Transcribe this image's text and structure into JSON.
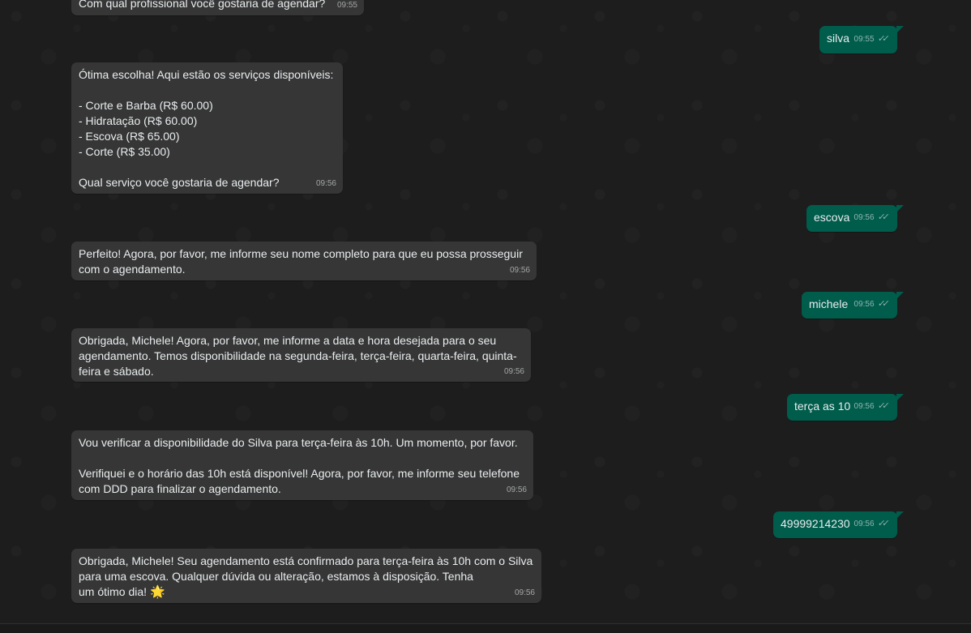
{
  "messages": [
    {
      "id": "m0",
      "dir": "in",
      "text": "Com qual profissional você gostaria de agendar?",
      "time": "09:55"
    },
    {
      "id": "m1",
      "dir": "out",
      "text": "silva",
      "time": "09:55"
    },
    {
      "id": "m2",
      "dir": "in",
      "text": "Ótima escolha! Aqui estão os serviços disponíveis:\n\n- Corte e Barba (R$ 60.00)\n- Hidratação (R$ 60.00)\n- Escova (R$ 65.00)\n- Corte (R$ 35.00)\n\nQual serviço você gostaria de agendar?",
      "time": "09:56"
    },
    {
      "id": "m3",
      "dir": "out",
      "text": "escova",
      "time": "09:56"
    },
    {
      "id": "m4",
      "dir": "in",
      "text": "Perfeito! Agora, por favor, me informe seu nome completo para que eu possa prosseguir\ncom o agendamento.",
      "time": "09:56"
    },
    {
      "id": "m5",
      "dir": "out",
      "text": "michele",
      "time": "09:56"
    },
    {
      "id": "m6",
      "dir": "in",
      "text": "Obrigada, Michele! Agora, por favor, me informe a data e hora desejada para o seu\nagendamento. Temos disponibilidade na segunda-feira, terça-feira, quarta-feira, quinta-\nfeira e sábado.",
      "time": "09:56"
    },
    {
      "id": "m7",
      "dir": "out",
      "text": "terça as 10",
      "time": "09:56"
    },
    {
      "id": "m8",
      "dir": "in",
      "text": "Vou verificar a disponibilidade do Silva para terça-feira às 10h. Um momento, por favor.\n\nVerifiquei e o horário das 10h está disponível! Agora, por favor, me informe seu telefone\ncom DDD para finalizar o agendamento.",
      "time": "09:56"
    },
    {
      "id": "m9",
      "dir": "out",
      "text": "49999214230",
      "time": "09:56"
    },
    {
      "id": "m10",
      "dir": "in",
      "text": "Obrigada, Michele! Seu agendamento está confirmado para terça-feira às 10h com o Silva\npara uma escova. Qualquer dúvida ou alteração, estamos à disposição. Tenha\num ótimo dia! ",
      "emoji": "🌟",
      "time": "09:56"
    }
  ],
  "read_receipt_icon": "double-check-icon",
  "colors": {
    "incoming_bubble": "#363636",
    "outgoing_bubble": "#005c4b",
    "background": "#1c1d1c",
    "text": "#e9edef"
  }
}
